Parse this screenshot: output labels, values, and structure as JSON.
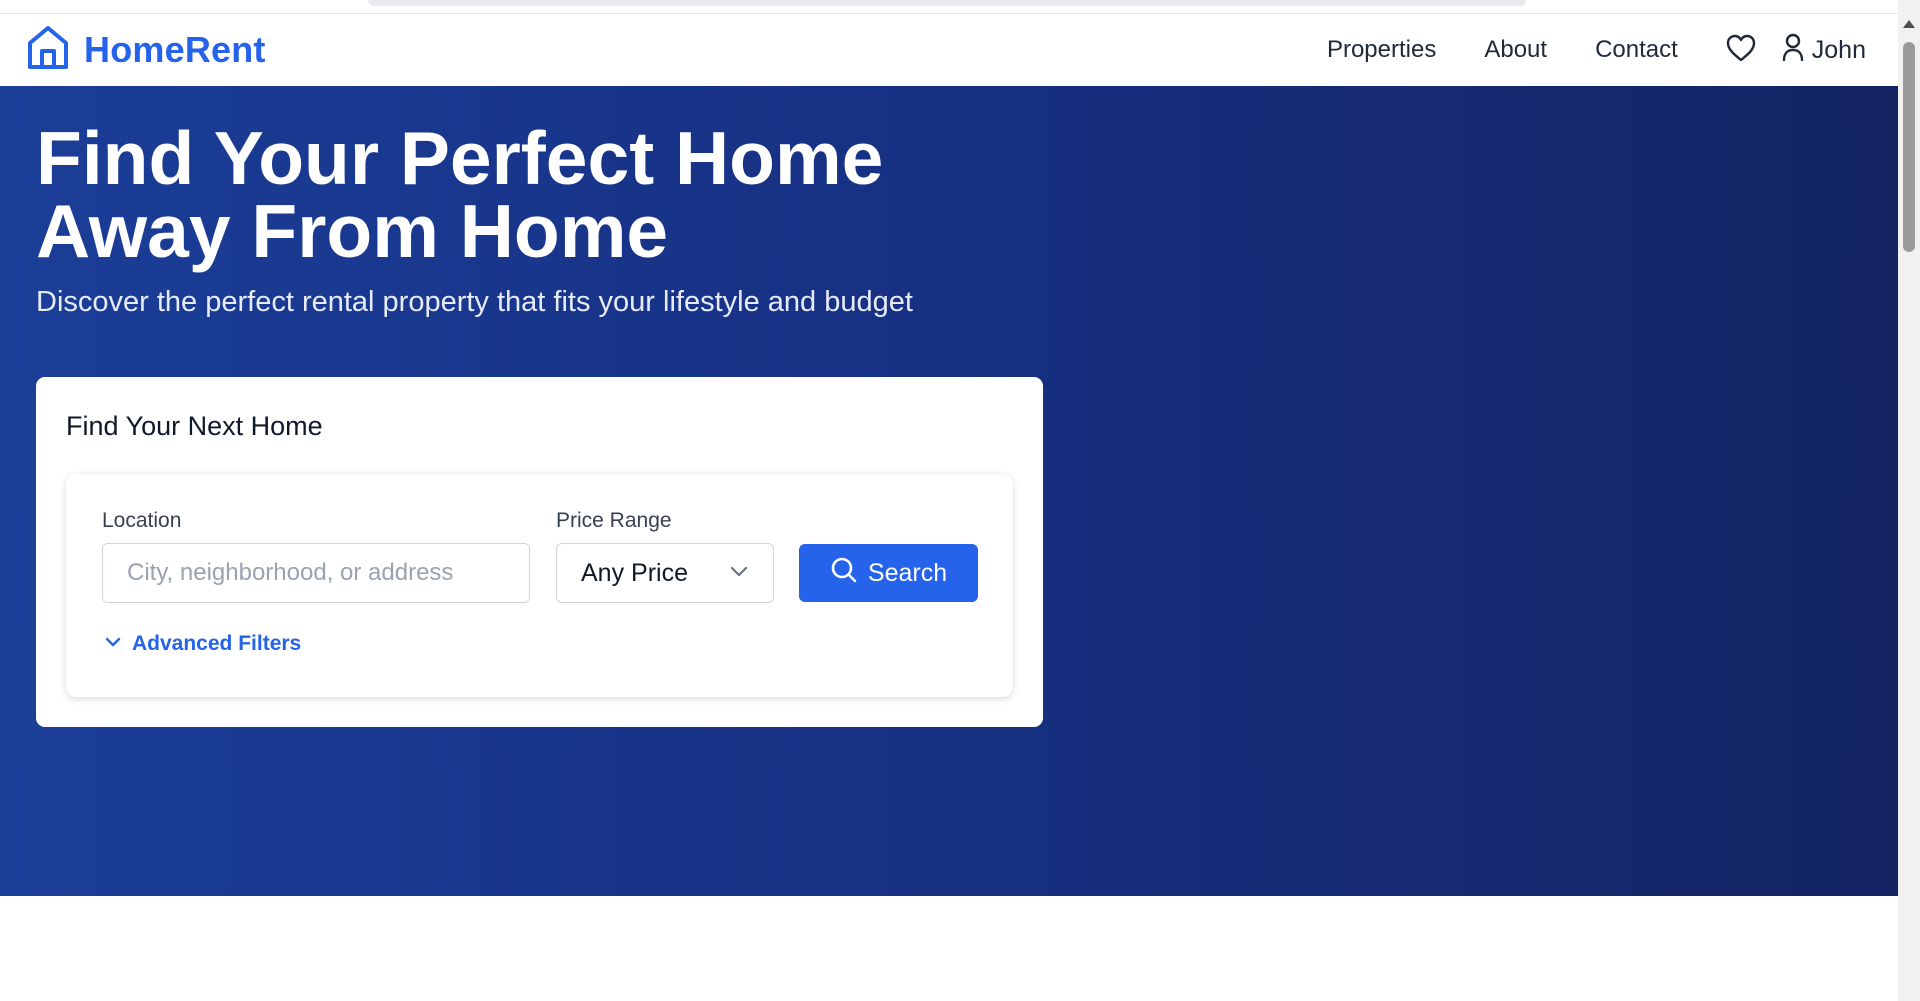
{
  "brand": {
    "name": "HomeRent",
    "logo_icon": "house-icon",
    "color": "#2563eb"
  },
  "nav": {
    "links": [
      "Properties",
      "About",
      "Contact"
    ],
    "favorites_icon": "heart-icon",
    "user_icon": "user-icon",
    "user_name": "John"
  },
  "hero": {
    "title_line1": "Find Your Perfect Home",
    "title_line2": "Away From Home",
    "subtitle": "Discover the perfect rental property that fits your lifestyle and budget",
    "colors": {
      "start": "#1b3e98",
      "end": "#142463"
    }
  },
  "search": {
    "card_title": "Find Your Next Home",
    "location_label": "Location",
    "location_placeholder": "City, neighborhood, or address",
    "location_value": "",
    "price_label": "Price Range",
    "price_value": "Any Price",
    "search_label": "Search",
    "advanced_filters_label": "Advanced Filters",
    "button_color": "#2563eb"
  }
}
